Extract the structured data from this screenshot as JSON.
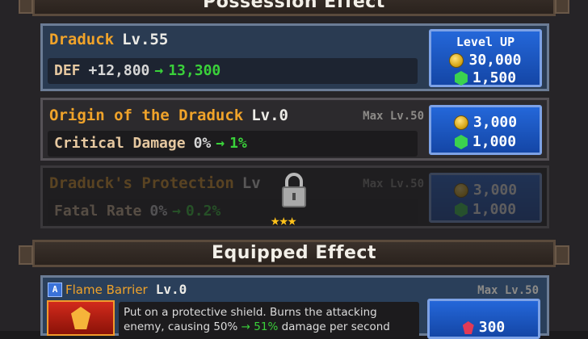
{
  "possession_header": "Possession Effect",
  "equipped_header": "Equipped Effect",
  "slots": [
    {
      "name": "Draduck",
      "level": "Lv.55",
      "stat_label": "DEF",
      "stat_current": "+12,800",
      "stat_next": "13,300",
      "button": {
        "title": "Level UP",
        "coin_cost": "30,000",
        "gem_cost": "1,500"
      }
    },
    {
      "name": "Origin of the Draduck",
      "level": "Lv.0",
      "max_level": "Max Lv.50",
      "stat_label": "Critical Damage",
      "stat_current": "0%",
      "stat_next": "1%",
      "button": {
        "coin_cost": "3,000",
        "gem_cost": "1,000"
      }
    },
    {
      "name": "Draduck's Protection",
      "level": "Lv",
      "max_level": "Max Lv.50",
      "stat_label": "Fatal Rate",
      "stat_current": "0%",
      "stat_next": "0.2%",
      "button": {
        "coin_cost": "3,000",
        "gem_cost": "1,000"
      },
      "locked": true,
      "unlock_stars": "★★★"
    }
  ],
  "skill": {
    "badge": "A",
    "name": "Flame Barrier",
    "level": "Lv.0",
    "max_level": "Max Lv.50",
    "desc_line1": "Put on a protective shield. Burns the attacking",
    "desc_line2_a": "enemy, causing 50%",
    "desc_line2_b": "51%",
    "desc_line2_c": "damage per second",
    "cost": "300"
  },
  "arrow": "→",
  "colors": {
    "accent_orange": "#f0a32a",
    "increase_green": "#3ad13a",
    "button_blue": "#1f5cc8"
  }
}
